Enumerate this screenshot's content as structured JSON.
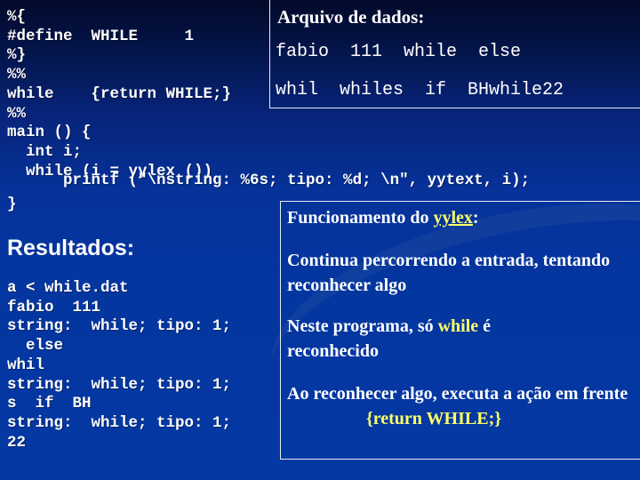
{
  "code": {
    "lines": [
      "%{",
      "#define  WHILE     1",
      "%}",
      "%%",
      "while    {return WHILE;}",
      "%%",
      "main () {",
      "  int i;",
      "  while (i = yylex ())"
    ],
    "printf_line": "      printf (\"\\nstring: %6s; tipo: %d; \\n\", yytext, i);",
    "close_brace": "}"
  },
  "data_file": {
    "title": "Arquivo de dados:",
    "line1": "fabio  111  while  else",
    "line2": "whil  whiles  if  BHwhile22"
  },
  "results": {
    "title": "Resultados:",
    "lines": [
      "a < while.dat",
      "fabio  111",
      "string:  while; tipo: 1;",
      "  else",
      "whil",
      "string:  while; tipo: 1;",
      "s  if  BH",
      "string:  while; tipo: 1;",
      "22"
    ]
  },
  "info": {
    "title_prefix": "Funcionamento  do ",
    "title_highlight": "yylex",
    "title_suffix": ":",
    "p1": "Continua percorrendo a entrada, tentando reconhecer algo",
    "p2_prefix": "Neste programa, só ",
    "p2_highlight": "while",
    "p2_suffix": " é reconhecido",
    "p3": "Ao reconhecer algo, executa a ação em frente",
    "p3_action": "{return WHILE;}"
  },
  "colors": {
    "background": "#0436a0",
    "highlight": "#ffff66",
    "text": "#ffffff"
  }
}
